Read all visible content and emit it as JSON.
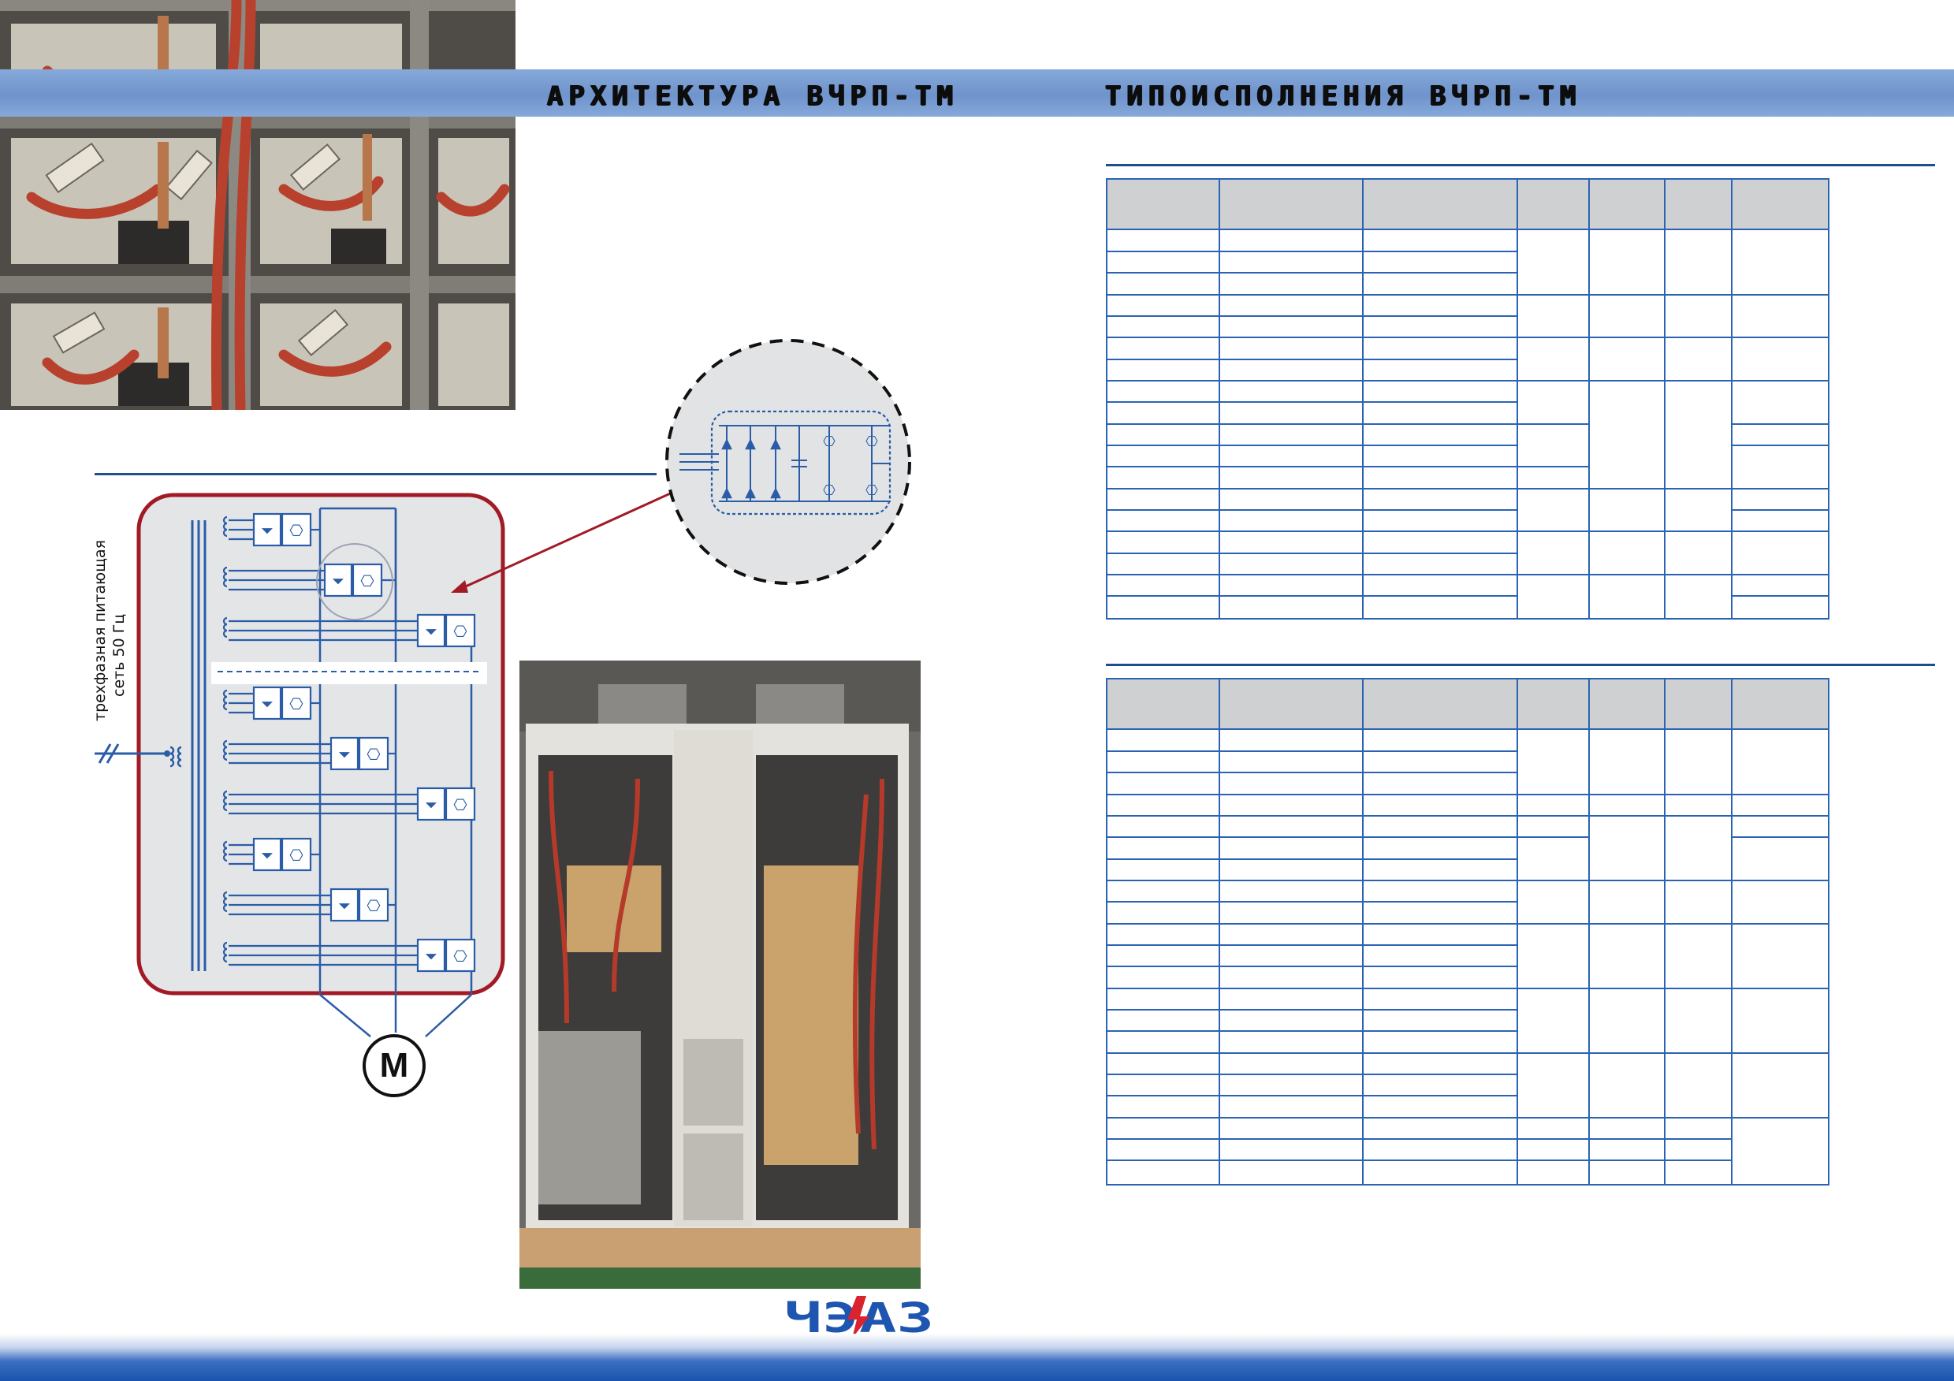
{
  "header": {
    "left_title": "АРХИТЕКТУРА ВЧРП-ТМ",
    "right_title": "ТИПОИСПОЛНЕНИЯ ВЧРП-ТМ"
  },
  "diagram": {
    "supply_label_line1": "трехфазная питающая",
    "supply_label_line2": "сеть 50 Гц",
    "motor_label": "M"
  },
  "brand": {
    "logo_text": "ЧЭАЗ"
  },
  "colors": {
    "band": "#7a9dd2",
    "rule": "#1f4d8e",
    "frame_red": "#a11a26",
    "circuit_blue": "#2a5ca8",
    "table_border": "#2b63b3",
    "table_header": "#cfd0d2",
    "logo_blue": "#1e55b0",
    "logo_red": "#d9232d"
  },
  "tables": [
    {
      "columns": 7,
      "rows": 18
    },
    {
      "columns": 7,
      "rows": 21
    }
  ]
}
